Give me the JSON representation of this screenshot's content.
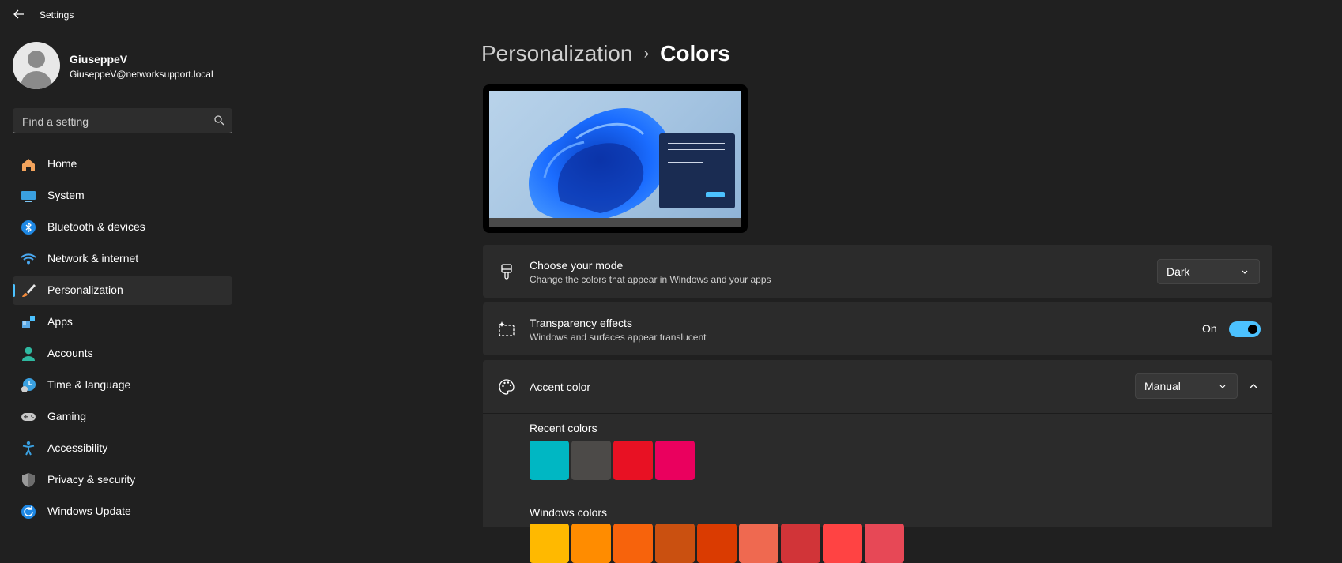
{
  "window": {
    "title": "Settings"
  },
  "user": {
    "name": "GiuseppeV",
    "email": "GiuseppeV@networksupport.local"
  },
  "search": {
    "placeholder": "Find a setting"
  },
  "nav": [
    {
      "label": "Home",
      "icon": "home-icon"
    },
    {
      "label": "System",
      "icon": "system-icon"
    },
    {
      "label": "Bluetooth & devices",
      "icon": "bluetooth-icon"
    },
    {
      "label": "Network & internet",
      "icon": "wifi-icon"
    },
    {
      "label": "Personalization",
      "icon": "brush-icon",
      "active": true
    },
    {
      "label": "Apps",
      "icon": "apps-icon"
    },
    {
      "label": "Accounts",
      "icon": "accounts-icon"
    },
    {
      "label": "Time & language",
      "icon": "time-language-icon"
    },
    {
      "label": "Gaming",
      "icon": "gamepad-icon"
    },
    {
      "label": "Accessibility",
      "icon": "accessibility-icon"
    },
    {
      "label": "Privacy & security",
      "icon": "shield-icon"
    },
    {
      "label": "Windows Update",
      "icon": "update-icon"
    }
  ],
  "breadcrumb": {
    "parent": "Personalization",
    "separator": "›",
    "current": "Colors"
  },
  "mode": {
    "title": "Choose your mode",
    "description": "Change the colors that appear in Windows and your apps",
    "value": "Dark"
  },
  "transparency": {
    "title": "Transparency effects",
    "description": "Windows and surfaces appear translucent",
    "state_label": "On",
    "enabled": true
  },
  "accent": {
    "title": "Accent color",
    "value": "Manual",
    "recent_label": "Recent colors",
    "recent_colors": [
      "#00b7c3",
      "#4c4a48",
      "#e81123",
      "#ea005e"
    ],
    "windows_label": "Windows colors",
    "windows_colors": [
      "#ffb900",
      "#ff8c00",
      "#f7630c",
      "#ca5010",
      "#da3b01",
      "#ef6950",
      "#d13438",
      "#ff4343",
      "#e74856"
    ]
  },
  "colors": {
    "accent": "#4cc2ff",
    "background": "#202020",
    "card": "#2b2b2b"
  }
}
